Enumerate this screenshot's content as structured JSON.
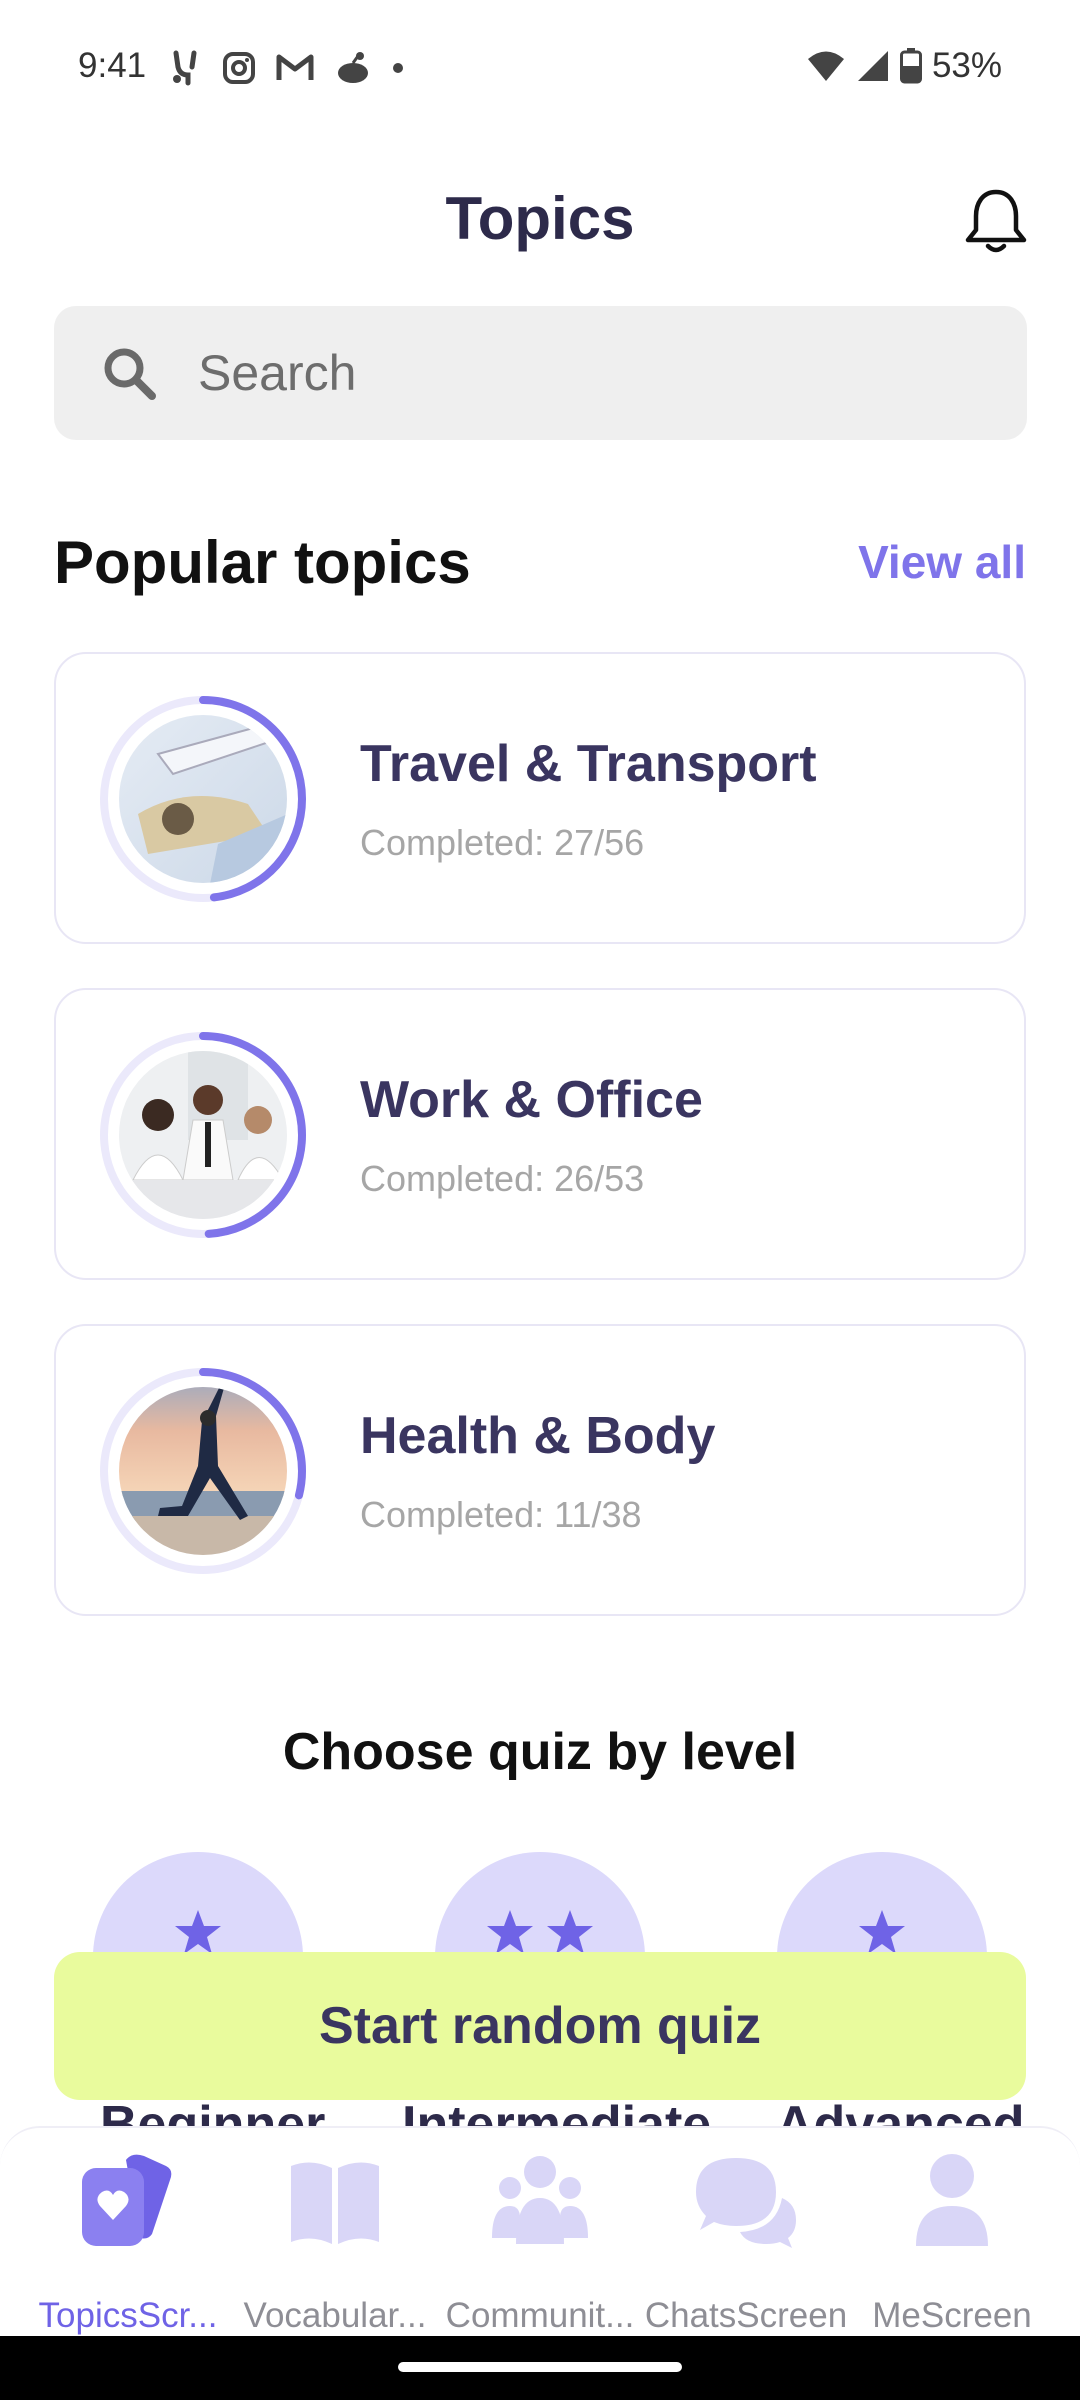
{
  "status_bar": {
    "time": "9:41",
    "battery": "53%",
    "icons": [
      "fork-icon",
      "instagram-icon",
      "gmail-icon",
      "reddit-icon",
      "dot-icon",
      "wifi-icon",
      "cell-signal-icon",
      "battery-icon"
    ]
  },
  "header": {
    "title": "Topics",
    "bell_icon": "bell-icon"
  },
  "search": {
    "placeholder": "Search",
    "value": ""
  },
  "popular": {
    "title": "Popular topics",
    "view_all": "View all",
    "topics": [
      {
        "name": "Travel & Transport",
        "progress_text": "Completed: 27/56",
        "completed": 27,
        "total": 56
      },
      {
        "name": "Work & Office",
        "progress_text": "Completed: 26/53",
        "completed": 26,
        "total": 53
      },
      {
        "name": "Health & Body",
        "progress_text": "Completed: 11/38",
        "completed": 11,
        "total": 38
      }
    ]
  },
  "quiz": {
    "title": "Choose quiz by level",
    "levels": [
      {
        "name": "Beginner",
        "stars": 1
      },
      {
        "name": "Intermediate",
        "stars": 2
      },
      {
        "name": "Advanced",
        "stars": 3
      }
    ],
    "start_button": "Start random quiz"
  },
  "bottom_nav": {
    "items": [
      {
        "label": "TopicsScr...",
        "icon": "cards-icon",
        "active": true
      },
      {
        "label": "Vocabular...",
        "icon": "book-icon",
        "active": false
      },
      {
        "label": "Communit...",
        "icon": "people-icon",
        "active": false
      },
      {
        "label": "ChatsScreen",
        "icon": "chat-icon",
        "active": false
      },
      {
        "label": "MeScreen",
        "icon": "person-icon",
        "active": false
      }
    ]
  },
  "colors": {
    "accent": "#7f74ea",
    "ring_track": "#ebe9fb",
    "level_circle": "#dcd9fb",
    "start_button": "#e9fb9d",
    "title": "#2d2a4a"
  }
}
